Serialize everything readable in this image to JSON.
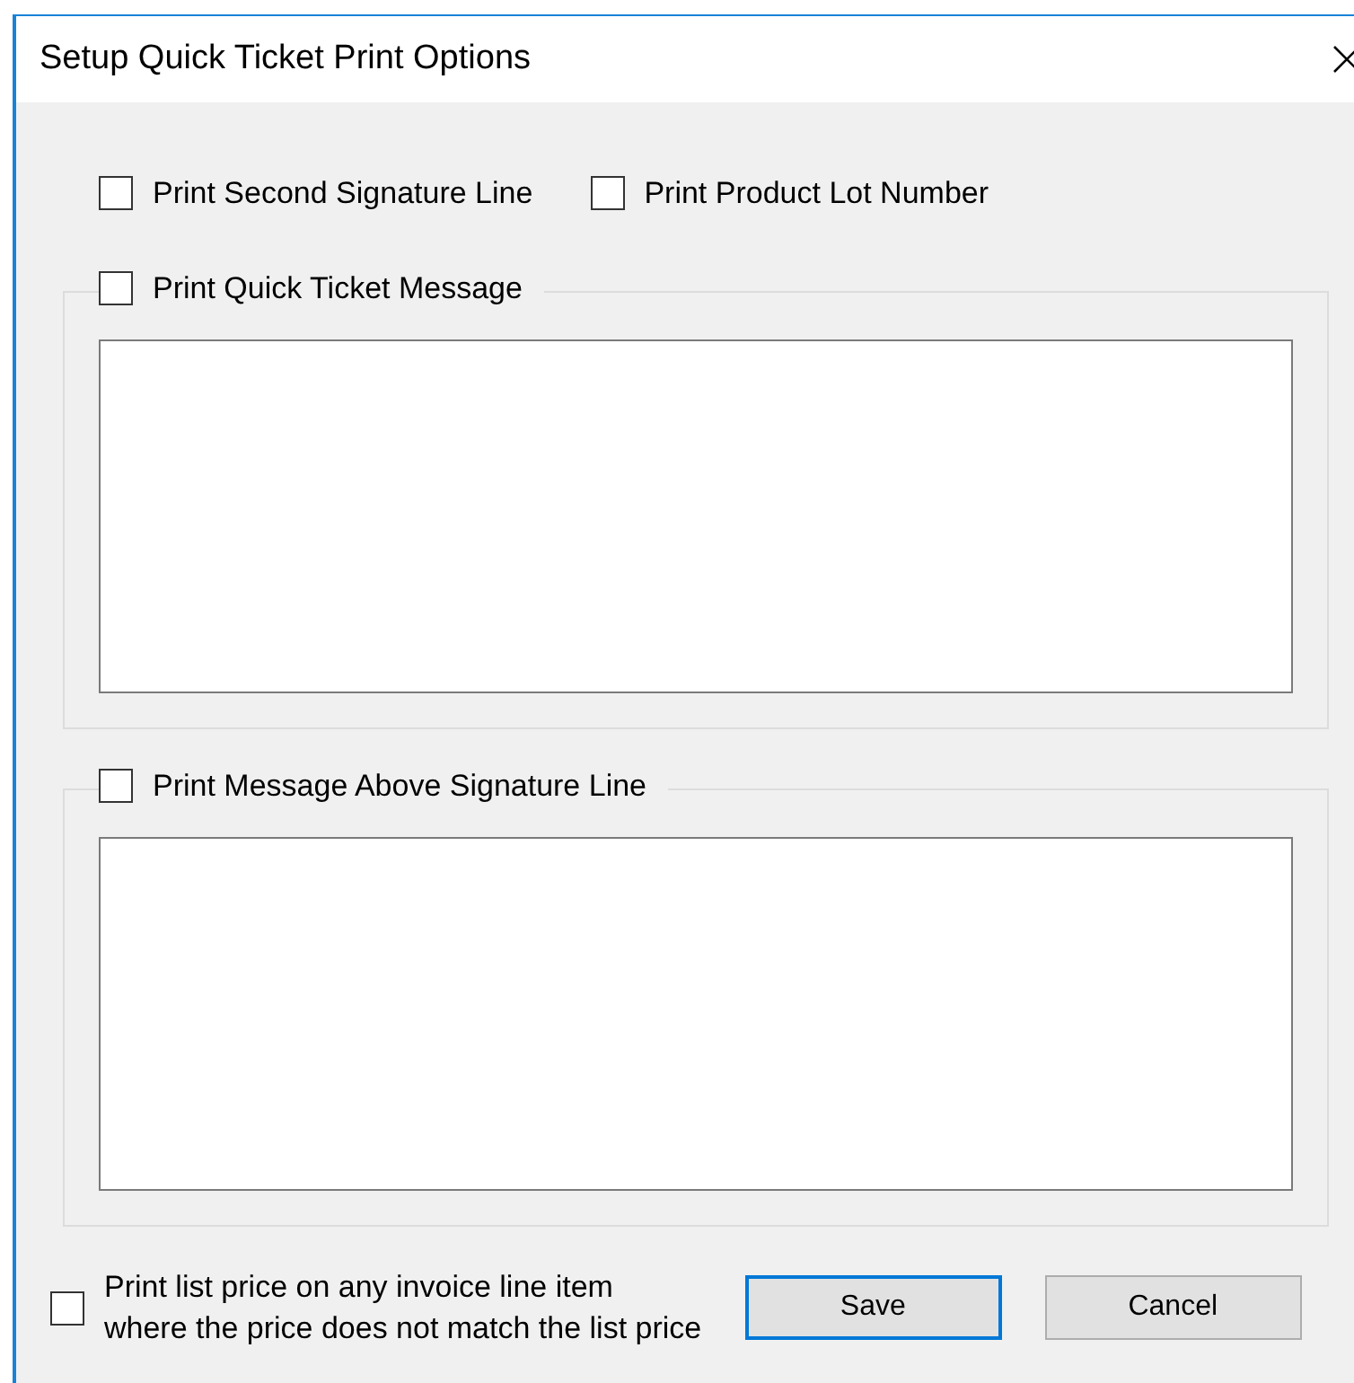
{
  "window": {
    "title": "Setup Quick Ticket Print Options"
  },
  "options": [
    {
      "label": "Print Second Signature Line",
      "checked": false
    },
    {
      "label": "Print Product Lot Number",
      "checked": false
    }
  ],
  "groups": [
    {
      "label": "Print Quick Ticket Message",
      "checked": false
    },
    {
      "label": "Print Message Above Signature Line",
      "checked": false
    }
  ],
  "list_price_option": {
    "label": "Print list price on any invoice line item\nwhere the price does not match the list price",
    "checked": false
  },
  "buttons": [
    {
      "label": "Save",
      "default": true
    },
    {
      "label": "Cancel",
      "default": false
    }
  ]
}
